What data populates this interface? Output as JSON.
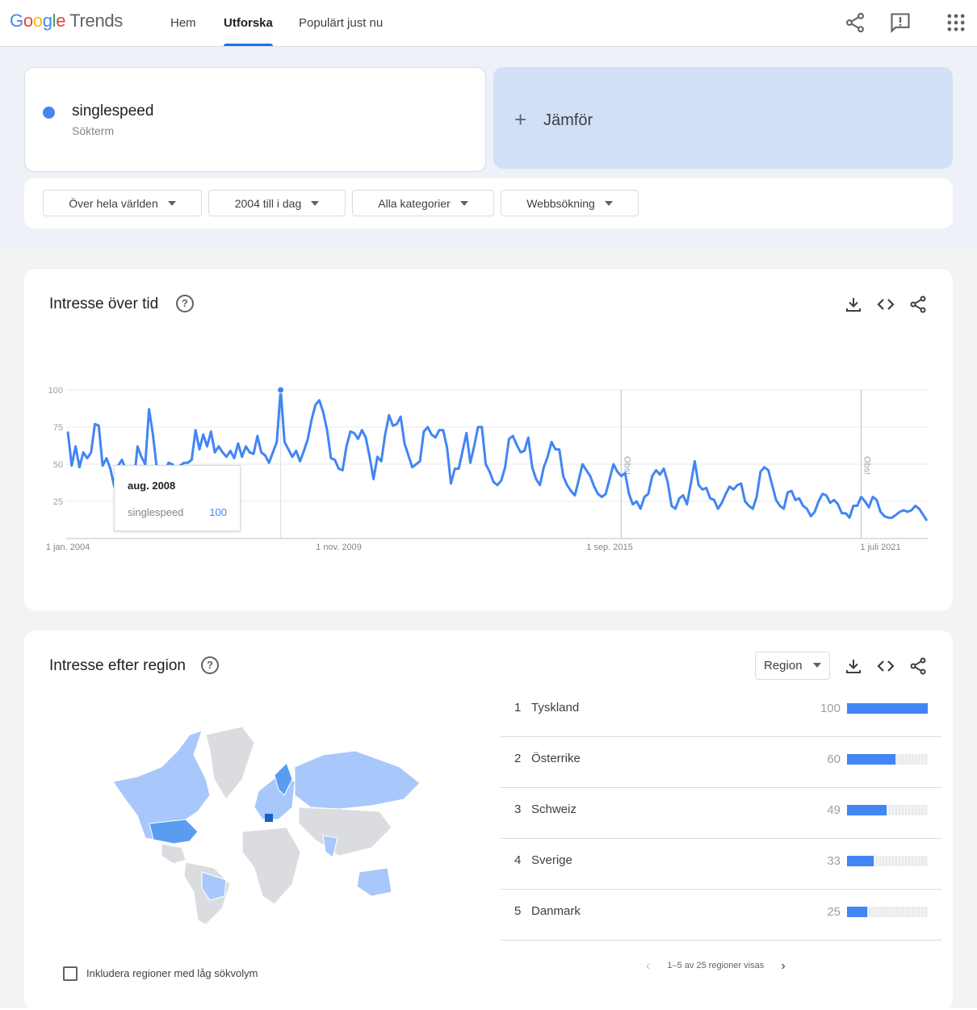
{
  "header": {
    "logo": {
      "letters": [
        "G",
        "o",
        "o",
        "g",
        "l",
        "e"
      ],
      "product": "Trends"
    },
    "nav": [
      {
        "label": "Hem"
      },
      {
        "label": "Utforska"
      },
      {
        "label": "Populärt just nu"
      }
    ],
    "icons": [
      "share-icon",
      "feedback-icon",
      "apps-grid-icon"
    ]
  },
  "search": {
    "term": "singlespeed",
    "term_type": "Sökterm",
    "term_color": "#4285f4",
    "compare_plus": "+",
    "compare_label": "Jämför"
  },
  "filters": [
    {
      "label": "Över hela världen"
    },
    {
      "label": "2004 till i dag"
    },
    {
      "label": "Alla kategorier"
    },
    {
      "label": "Webbsökning"
    }
  ],
  "interest_over_time": {
    "title": "Intresse över tid",
    "help": "?",
    "tooltip": {
      "date": "aug. 2008",
      "term": "singlespeed",
      "value": "100"
    }
  },
  "chart_data": {
    "type": "line",
    "start": "2004-01",
    "end": "2023-09",
    "yticks": [
      25,
      50,
      75,
      100
    ],
    "ylim": [
      0,
      100
    ],
    "xticks": [
      {
        "label": "1 jan. 2004",
        "month_index": 0
      },
      {
        "label": "1 nov. 2009",
        "month_index": 70
      },
      {
        "label": "1 sep. 2015",
        "month_index": 140
      },
      {
        "label": "1 juli 2021",
        "month_index": 210
      }
    ],
    "notes": [
      {
        "label": "Obs!",
        "month_index": 143
      },
      {
        "label": "Obs!",
        "month_index": 205
      }
    ],
    "hover_month_index": 55,
    "line_color": "#4285f4",
    "series": [
      {
        "name": "singlespeed",
        "values": [
          72,
          49,
          62,
          48,
          58,
          54,
          58,
          77,
          76,
          49,
          54,
          47,
          35,
          49,
          53,
          46,
          40,
          36,
          62,
          55,
          50,
          87,
          70,
          47,
          46,
          42,
          51,
          50,
          45,
          49,
          51,
          51,
          53,
          73,
          60,
          70,
          62,
          72,
          58,
          62,
          58,
          55,
          59,
          54,
          64,
          55,
          62,
          58,
          57,
          69,
          58,
          56,
          51,
          58,
          65,
          100,
          65,
          60,
          55,
          59,
          52,
          59,
          67,
          80,
          90,
          93,
          85,
          73,
          54,
          53,
          47,
          46,
          62,
          72,
          71,
          67,
          73,
          68,
          55,
          40,
          55,
          52,
          70,
          83,
          76,
          77,
          82,
          64,
          56,
          48,
          50,
          52,
          72,
          75,
          70,
          68,
          73,
          73,
          61,
          37,
          47,
          47,
          59,
          71,
          51,
          62,
          75,
          75,
          50,
          45,
          38,
          36,
          39,
          48,
          67,
          69,
          63,
          58,
          59,
          68,
          48,
          40,
          36,
          48,
          55,
          65,
          60,
          60,
          42,
          36,
          32,
          29,
          39,
          50,
          46,
          42,
          35,
          30,
          28,
          30,
          40,
          50,
          45,
          42,
          44,
          30,
          23,
          25,
          20,
          28,
          30,
          42,
          46,
          43,
          47,
          38,
          22,
          20,
          27,
          29,
          23,
          37,
          52,
          36,
          33,
          34,
          27,
          26,
          20,
          24,
          30,
          35,
          33,
          36,
          37,
          25,
          22,
          20,
          28,
          45,
          48,
          46,
          36,
          26,
          22,
          20,
          31,
          32,
          26,
          27,
          22,
          20,
          15,
          18,
          25,
          30,
          29,
          24,
          26,
          23,
          17,
          17,
          14,
          22,
          22,
          28,
          25,
          21,
          28,
          26,
          18,
          15,
          14,
          14,
          16,
          18,
          19,
          18,
          19,
          22,
          20,
          16,
          12
        ]
      }
    ]
  },
  "interest_by_region": {
    "title": "Intresse efter region",
    "help": "?",
    "resolution": "Region",
    "rows": [
      {
        "rank": "1",
        "name": "Tyskland",
        "value": 100
      },
      {
        "rank": "2",
        "name": "Österrike",
        "value": 60
      },
      {
        "rank": "3",
        "name": "Schweiz",
        "value": 49
      },
      {
        "rank": "4",
        "name": "Sverige",
        "value": 33
      },
      {
        "rank": "5",
        "name": "Danmark",
        "value": 25
      }
    ],
    "pagination": "1–5 av 25 regioner visas",
    "low_volume_label": "Inkludera regioner med låg sökvolym",
    "map_colors": {
      "high": "#1a5fc7",
      "mid": "#5b9cf0",
      "low": "#a8c7fa",
      "none": "#dadce0"
    }
  }
}
